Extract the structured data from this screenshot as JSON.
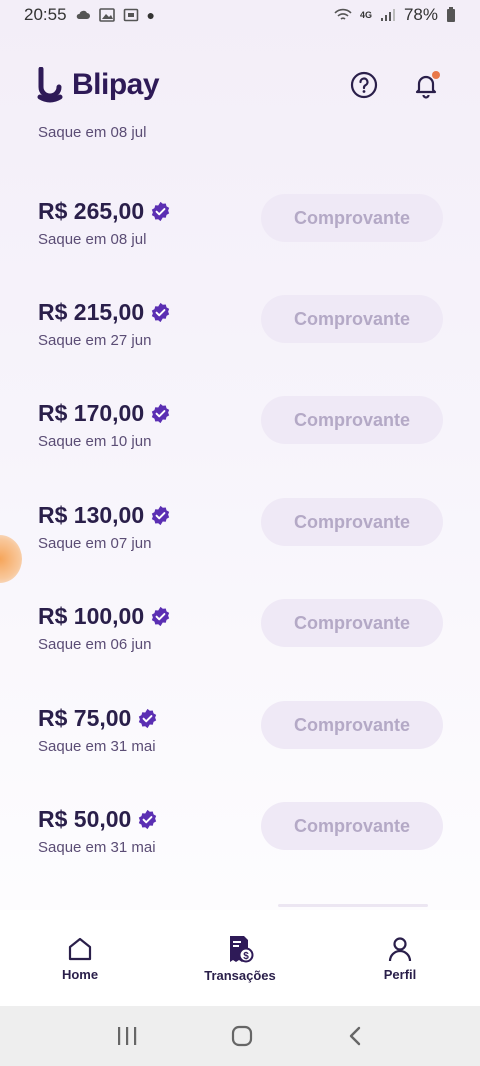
{
  "status_bar": {
    "time": "20:55",
    "network": "4G",
    "battery": "78%"
  },
  "header": {
    "logo_text": "Blipay",
    "help_icon": "help-circle-icon",
    "bell_icon": "bell-icon"
  },
  "list": {
    "partial_date": "Saque em 08 jul",
    "button_label": "Comprovante",
    "items": [
      {
        "amount": "R$ 265,00",
        "date": "Saque em 08 jul"
      },
      {
        "amount": "R$ 215,00",
        "date": "Saque em 27 jun"
      },
      {
        "amount": "R$ 170,00",
        "date": "Saque em 10 jun"
      },
      {
        "amount": "R$ 130,00",
        "date": "Saque em 07 jun"
      },
      {
        "amount": "R$ 100,00",
        "date": "Saque em 06 jun"
      },
      {
        "amount": "R$ 75,00",
        "date": "Saque em 31 mai"
      },
      {
        "amount": "R$ 50,00",
        "date": "Saque em 31 mai"
      }
    ]
  },
  "bottom_nav": {
    "home": "Home",
    "transactions": "Transações",
    "profile": "Perfil"
  },
  "colors": {
    "brand": "#2e1a57",
    "badge": "#5b2fb3",
    "notification": "#e8784a"
  }
}
